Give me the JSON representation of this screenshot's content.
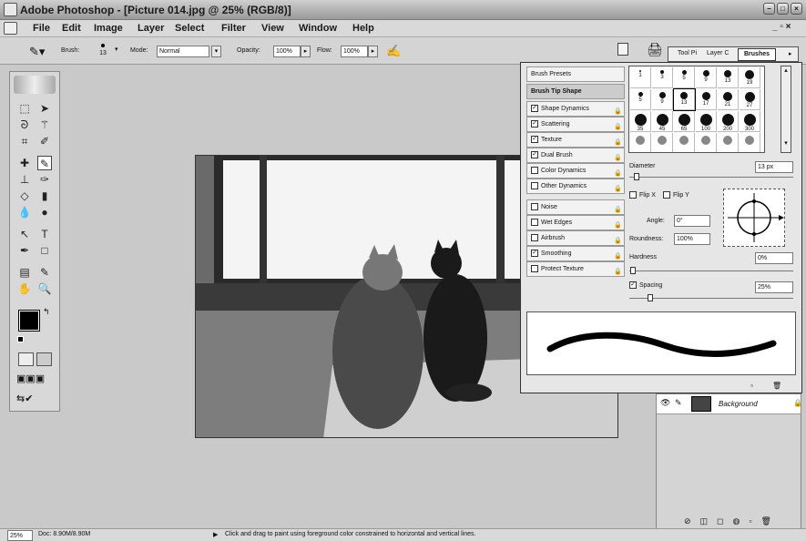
{
  "window": {
    "title": "Adobe Photoshop - [Picture 014.jpg @ 25% (RGB/8)]"
  },
  "menu": [
    "File",
    "Edit",
    "Image",
    "Layer",
    "Select",
    "Filter",
    "View",
    "Window",
    "Help"
  ],
  "options": {
    "brush_label": "Brush:",
    "brush_size": "13",
    "mode_label": "Mode:",
    "mode_value": "Normal",
    "opacity_label": "Opacity:",
    "opacity_value": "100%",
    "flow_label": "Flow:",
    "flow_value": "100%"
  },
  "panel_tabs": [
    "Tool Pi",
    "Layer C",
    "Brushes"
  ],
  "brushes": {
    "presets_label": "Brush Presets",
    "tip_shape_label": "Brush Tip Shape",
    "options": [
      {
        "label": "Shape Dynamics",
        "checked": true
      },
      {
        "label": "Scattering",
        "checked": true
      },
      {
        "label": "Texture",
        "checked": true
      },
      {
        "label": "Dual Brush",
        "checked": true
      },
      {
        "label": "Color Dynamics",
        "checked": false
      },
      {
        "label": "Other Dynamics",
        "checked": false
      },
      {
        "label": "Noise",
        "checked": false
      },
      {
        "label": "Wet Edges",
        "checked": false
      },
      {
        "label": "Airbrush",
        "checked": false
      },
      {
        "label": "Smoothing",
        "checked": true
      },
      {
        "label": "Protect Texture",
        "checked": false
      }
    ],
    "tip_sizes": [
      [
        "1",
        "3",
        "5",
        "9",
        "13",
        "19"
      ],
      [
        "5",
        "9",
        "13",
        "17",
        "21",
        "27"
      ],
      [
        "35",
        "45",
        "65",
        "100",
        "200",
        "300"
      ]
    ],
    "diameter_label": "Diameter",
    "diameter_value": "13 px",
    "flip_x_label": "Flip X",
    "flip_y_label": "Flip Y",
    "angle_label": "Angle:",
    "angle_value": "0°",
    "roundness_label": "Roundness:",
    "roundness_value": "100%",
    "hardness_label": "Hardness",
    "hardness_value": "0%",
    "spacing_label": "Spacing",
    "spacing_value": "25%"
  },
  "layers": {
    "background_label": "Background"
  },
  "status": {
    "zoom": "25%",
    "doc": "Doc: 8.90M/8.90M",
    "hint": "Click and drag to paint using foreground color constrained to horizontal and vertical lines."
  }
}
